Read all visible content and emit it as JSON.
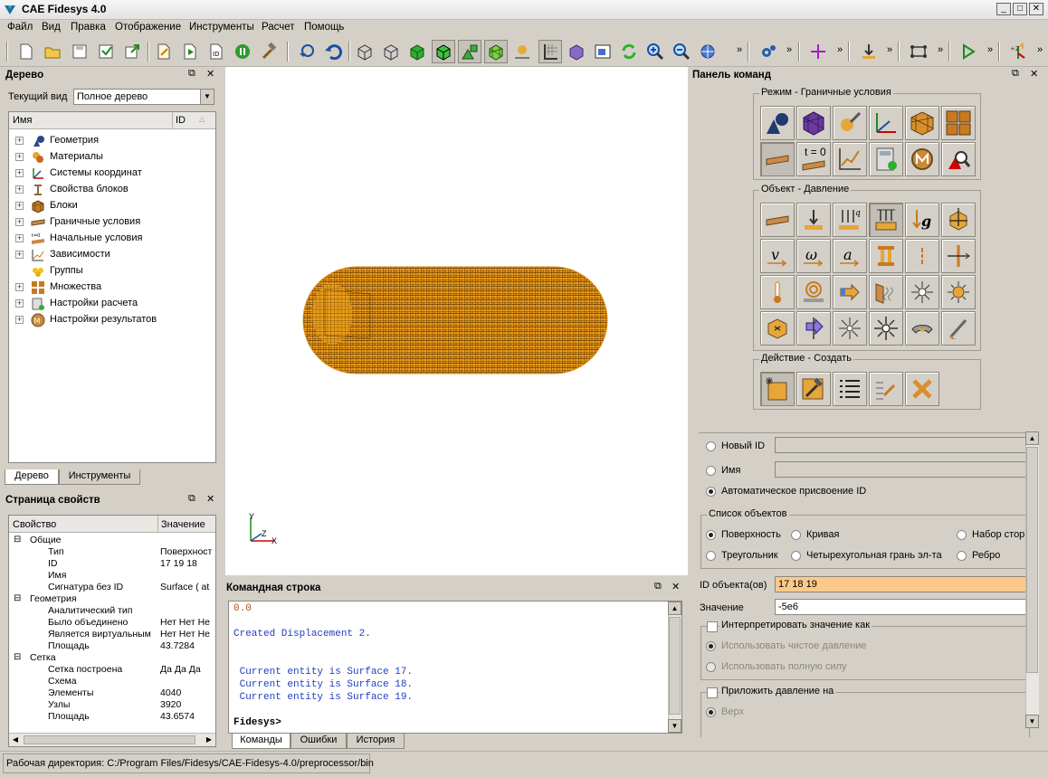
{
  "window": {
    "title": "CAE Fidesys 4.0",
    "btn_min": "_",
    "btn_max": "□",
    "btn_close": "✕"
  },
  "menu": [
    "Файл",
    "Вид",
    "Правка",
    "Отображение",
    "Инструменты",
    "Расчет",
    "Помощь"
  ],
  "toolbar": {
    "more": "»"
  },
  "tree_panel": {
    "title": "Дерево",
    "view_label": "Текущий вид",
    "view_value": "Полное дерево",
    "col_name": "Имя",
    "col_id": "ID",
    "items": [
      "Геометрия",
      "Материалы",
      "Системы координат",
      "Свойства блоков",
      "Блоки",
      "Граничные условия",
      "Начальные условия",
      "Зависимости",
      "Группы",
      "Множества",
      "Настройки расчета",
      "Настройки результатов"
    ],
    "tabs": [
      "Дерево",
      "Инструменты"
    ]
  },
  "props_panel": {
    "title": "Страница свойств",
    "col_prop": "Свойство",
    "col_val": "Значение",
    "rows": [
      {
        "k": "Общие",
        "v": "",
        "level": 0
      },
      {
        "k": "Тип",
        "v": "Поверхност",
        "level": 1
      },
      {
        "k": "ID",
        "v": "17 19 18",
        "level": 1
      },
      {
        "k": "Имя",
        "v": "",
        "level": 1
      },
      {
        "k": "Сигнатура без ID",
        "v": "Surface ( at",
        "level": 1
      },
      {
        "k": "Геометрия",
        "v": "",
        "level": 0
      },
      {
        "k": "Аналитический тип",
        "v": "",
        "level": 1
      },
      {
        "k": "Было объединено",
        "v": "Нет Нет Не",
        "level": 1
      },
      {
        "k": "Является виртуальным",
        "v": "Нет Нет Не",
        "level": 1
      },
      {
        "k": "Площадь",
        "v": "43.7284",
        "level": 1
      },
      {
        "k": "Сетка",
        "v": "",
        "level": 0
      },
      {
        "k": "Сетка построена",
        "v": "Да Да Да",
        "level": 1
      },
      {
        "k": "Схема",
        "v": "",
        "level": 1
      },
      {
        "k": "Элементы",
        "v": "4040",
        "level": 1
      },
      {
        "k": "Узлы",
        "v": "3920",
        "level": 1
      },
      {
        "k": "Площадь",
        "v": "43.6574",
        "level": 1
      }
    ]
  },
  "axes": {
    "y": "Y",
    "z": "Z",
    "x": "X"
  },
  "cmdline": {
    "title": "Командная строка",
    "lines": [
      "0.0",
      "",
      "Created Displacement 2.",
      "",
      "",
      " Current entity is Surface 17.",
      " Current entity is Surface 18.",
      " Current entity is Surface 19.",
      "",
      "Fidesys>"
    ],
    "tabs": [
      "Команды",
      "Ошибки",
      "История"
    ]
  },
  "command_panel": {
    "title": "Панель команд",
    "mode_group": "Режим - Граничные условия",
    "t0_label": "t = 0",
    "object_group": "Объект - Давление",
    "action_group": "Действие - Создать",
    "new_id": "Новый ID",
    "name": "Имя",
    "auto_id": "Автоматическое присвоение ID",
    "objects_group": "Список объектов",
    "obj_options": [
      "Поверхность",
      "Кривая",
      "Набор стор",
      "Треугольник",
      "Четырехугольная грань эл-та",
      "Ребро"
    ],
    "obj_ids_label": "ID объекта(ов)",
    "obj_ids_value": "17 18 19",
    "value_label": "Значение",
    "value_value": "-5e6",
    "interpret_label": "Интерпретировать значение как",
    "pure_pressure": "Использовать чистое давление",
    "full_force": "Использовать полную силу",
    "apply_label": "Приложить давление на",
    "top_label": "Верх"
  },
  "status": {
    "workdir": "Рабочая директория: C:/Program Files/Fidesys/CAE-Fidesys-4.0/preprocessor/bin"
  },
  "colors": {
    "mesh_orange": "#f6a21c",
    "input_highlight": "#fdc98b",
    "code_blue": "#1f3fbf",
    "code_brown": "#a0521d"
  }
}
